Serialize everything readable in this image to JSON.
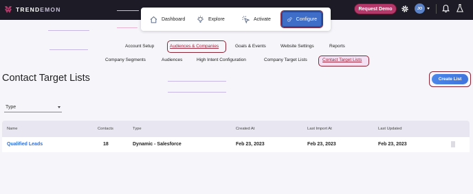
{
  "brand": {
    "name_main": "TREND",
    "name_accent": "EMON"
  },
  "topbar": {
    "request_demo": "Request Demo",
    "avatar_initials": "JO"
  },
  "modules": [
    {
      "label": "Dashboard",
      "icon": "home-icon"
    },
    {
      "label": "Explore",
      "icon": "lightbulb-icon"
    },
    {
      "label": "Activate",
      "icon": "cursor-click-icon"
    },
    {
      "label": "Configure",
      "icon": "gears-icon",
      "active": true
    }
  ],
  "subnav": {
    "row1": [
      "Account Setup",
      "Audiences & Companies",
      "Goals & Events",
      "Website Settings",
      "Reports"
    ],
    "row2": [
      "Company Segments",
      "Audiences",
      "High Intent Configuration",
      "Company Target Lists",
      "Contact Target Lists"
    ]
  },
  "page": {
    "title": "Contact Target Lists",
    "create_button": "Create List",
    "filter_label": "Type"
  },
  "table": {
    "columns": [
      "Name",
      "Contacts",
      "Type",
      "Created At",
      "Last Import At",
      "Last Updated"
    ],
    "rows": [
      [
        "Qualified Leads",
        "18",
        "Dynamic - Salesforce",
        "Feb 23, 2023",
        "Feb 23, 2023",
        "Feb 23, 2023"
      ]
    ]
  },
  "colors": {
    "topbar": "#1d1b25",
    "accent_blue": "#3f6ec9",
    "highlight_ring": "#8b2335",
    "request_demo": "#b5386a",
    "link": "#2f6fd6"
  }
}
